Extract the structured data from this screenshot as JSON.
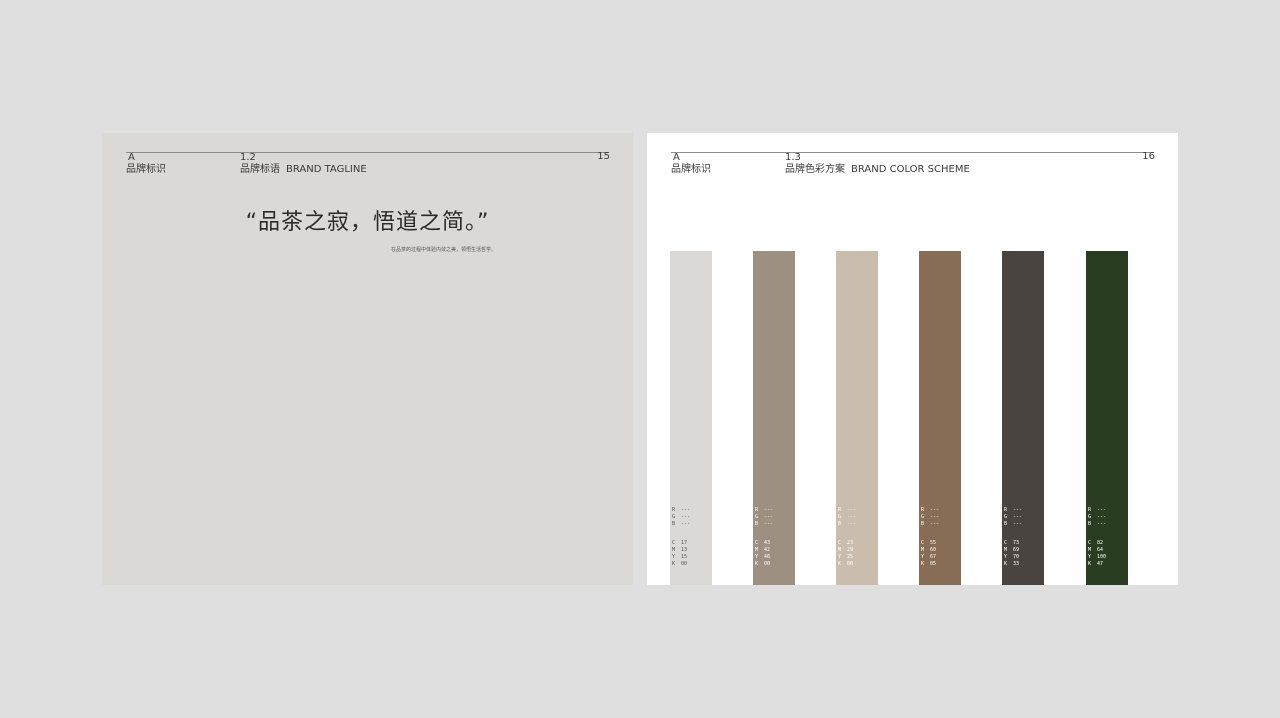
{
  "left_page": {
    "section_letter": "A",
    "section_name": "品牌标识",
    "sub_number": "1.2",
    "sub_title_cn": "品牌标语",
    "sub_title_en": "BRAND TAGLINE",
    "page_number": "15",
    "tagline": "“品茶之寂，悟道之简。”",
    "tagline_sub": "在品茶的过程中体验内敛之美，领悟生活哲学。",
    "background": "#dad9d5"
  },
  "right_page": {
    "section_letter": "A",
    "section_name": "品牌标识",
    "sub_number": "1.3",
    "sub_title_cn": "品牌色彩方案",
    "sub_title_en": "BRAND COLOR SCHEME",
    "page_number": "16",
    "background": "#ffffff",
    "swatches": [
      {
        "color": "#dad9d5",
        "text_color": "#555555",
        "R": "---",
        "G": "---",
        "B": "---",
        "C": "17",
        "M": "13",
        "Y": "15",
        "K": "00"
      },
      {
        "color": "#9e9081",
        "text_color": "#ffffff",
        "R": "---",
        "G": "---",
        "B": "---",
        "C": "43",
        "M": "42",
        "Y": "46",
        "K": "00"
      },
      {
        "color": "#cbbdad",
        "text_color": "#ffffff",
        "R": "---",
        "G": "---",
        "B": "---",
        "C": "23",
        "M": "29",
        "Y": "25",
        "K": "00"
      },
      {
        "color": "#876c56",
        "text_color": "#ffffff",
        "R": "---",
        "G": "---",
        "B": "---",
        "C": "55",
        "M": "60",
        "Y": "67",
        "K": "05"
      },
      {
        "color": "#4a4440",
        "text_color": "#ffffff",
        "R": "---",
        "G": "---",
        "B": "---",
        "C": "73",
        "M": "69",
        "Y": "70",
        "K": "33"
      },
      {
        "color": "#293d20",
        "text_color": "#ffffff",
        "R": "---",
        "G": "---",
        "B": "---",
        "C": "82",
        "M": "64",
        "Y": "100",
        "K": "47"
      }
    ]
  }
}
